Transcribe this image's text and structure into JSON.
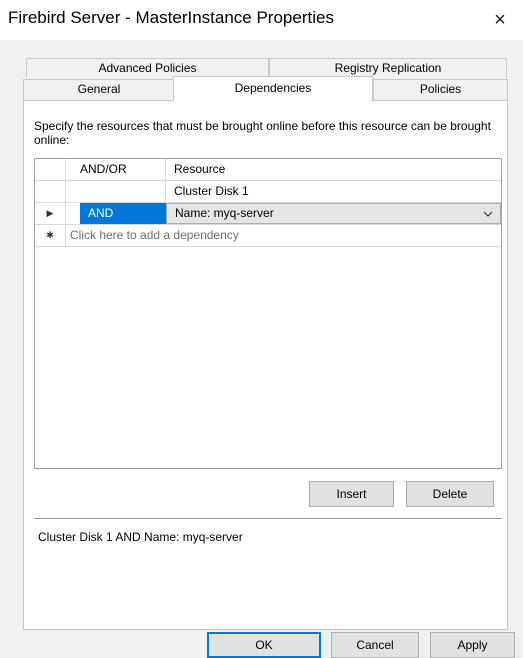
{
  "window": {
    "title": "Firebird Server - MasterInstance Properties",
    "close_glyph": "×"
  },
  "tabs": {
    "row1": [
      "Advanced Policies",
      "Registry Replication"
    ],
    "row2": [
      "General",
      "Dependencies",
      "Policies"
    ],
    "active": "Dependencies"
  },
  "dependencies": {
    "description": "Specify the resources that must be brought online before this resource can be brought online:",
    "columns": {
      "andor": "AND/OR",
      "resource": "Resource"
    },
    "rows": [
      {
        "selector": "",
        "andor": "",
        "resource": "Cluster Disk 1"
      },
      {
        "selector": "▶",
        "andor": "AND",
        "resource": "Name: myq-server"
      }
    ],
    "new_row": {
      "selector": "✱",
      "placeholder": "Click here to add a dependency"
    },
    "insert_label": "Insert",
    "delete_label": "Delete",
    "expression": "Cluster Disk 1 AND Name: myq-server"
  },
  "footer": {
    "ok_label": "OK",
    "cancel_label": "Cancel",
    "apply_label": "Apply"
  },
  "colors": {
    "selection": "#0078d7",
    "window_bg": "#f0f0f0"
  }
}
